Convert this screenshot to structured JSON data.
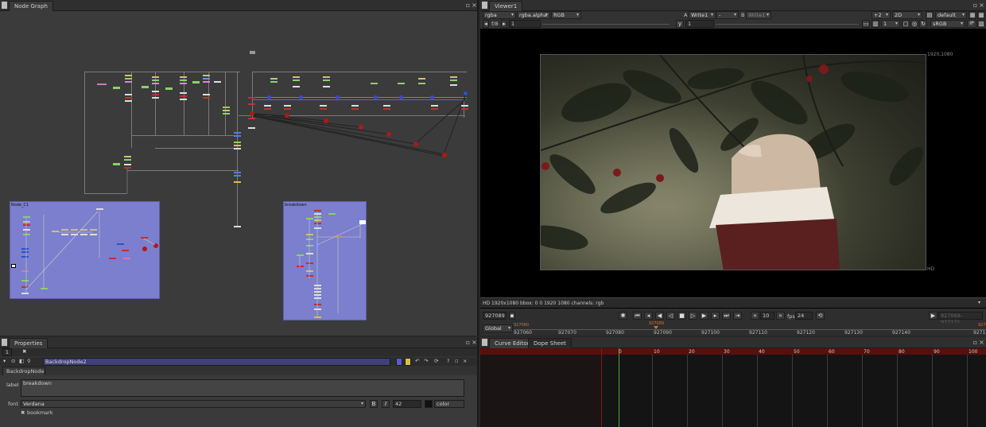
{
  "node_graph": {
    "tab_label": "Node Graph",
    "backdrop1_label": "Node_C1",
    "backdrop2_label": "breakdown"
  },
  "viewer": {
    "tab_label": "Viewer1",
    "channels": "rgba",
    "alpha_channel": "rgba.alpha",
    "display_channels": "RGB",
    "input_a_label": "A",
    "input_a": "Write1",
    "blend_mode": "-",
    "input_b_label": "B",
    "input_b": "Write1",
    "zoom_level": "+2",
    "view_mode": "2D",
    "lut": "default",
    "fstop": "f/8",
    "gain": "1",
    "gamma_label": "y",
    "gamma": "1",
    "proxy_scale": "1",
    "colorspace": "sRGB",
    "ip_label": "IP",
    "format_corner": "1920,1080",
    "format_label": "HD",
    "status_line": "HD 1920x1080 bbox: 0 0 1920 1080 channels: rgb"
  },
  "timeline": {
    "current_frame": "927089",
    "step": "10",
    "fps_label": "fps",
    "fps": "24",
    "scope": "Global",
    "range_display": "927069-927171",
    "start_marker": "927060",
    "playhead_marker": "927089",
    "end_marker": "927171",
    "ticks": [
      "927060",
      "927070",
      "927080",
      "927090",
      "927100",
      "927110",
      "927120",
      "927130",
      "927140",
      "9271"
    ]
  },
  "properties": {
    "tab_label": "Properties",
    "node_name": "BackdropNode2",
    "node_class": "BackdropNode",
    "label_caption": "label",
    "label_value": "breakdown",
    "font_caption": "font",
    "font_value": "Verdana",
    "bold_btn": "B",
    "italic_btn": "I",
    "font_size": "42",
    "color_label": "color",
    "bookmark_label": "bookmark",
    "counter": "1"
  },
  "curve_editor": {
    "tab_curve": "Curve Editor",
    "tab_dope": "Dope Sheet",
    "frame_numbers": [
      "0",
      "10",
      "20",
      "30",
      "40",
      "50",
      "60",
      "70",
      "80",
      "90",
      "100"
    ]
  },
  "colors": {
    "backdrop": "#7b7fcd",
    "timeline_red": "#6a1010",
    "playhead_orange": "#e07020",
    "node_green": "#8bd06a",
    "node_red": "#b01818"
  }
}
